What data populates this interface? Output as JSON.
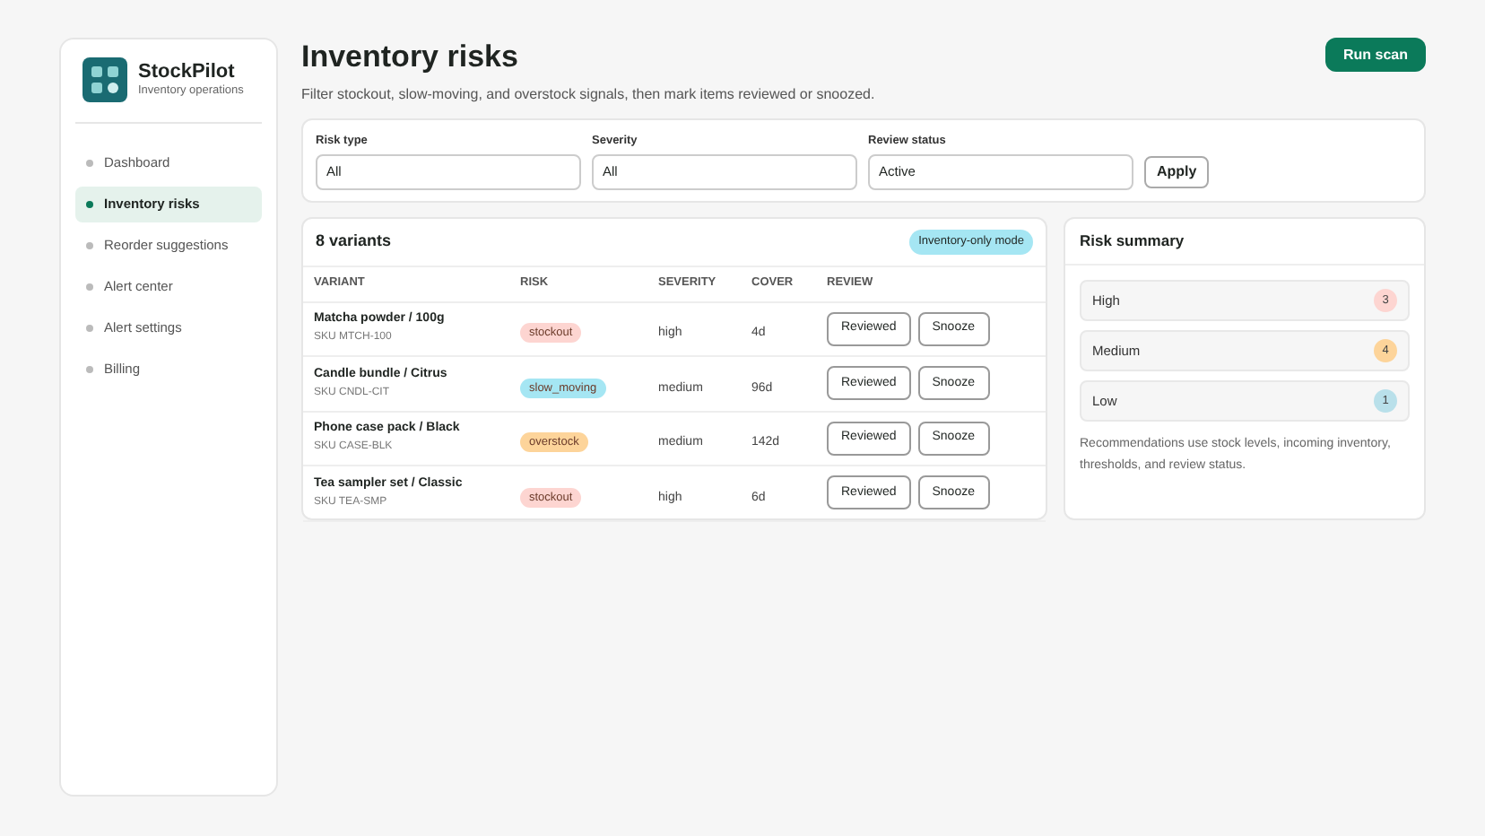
{
  "brand": {
    "name": "StockPilot",
    "subtitle": "Inventory operations"
  },
  "nav": [
    {
      "label": "Dashboard",
      "selected": false
    },
    {
      "label": "Inventory risks",
      "selected": true
    },
    {
      "label": "Reorder suggestions",
      "selected": false
    },
    {
      "label": "Alert center",
      "selected": false
    },
    {
      "label": "Alert settings",
      "selected": false
    },
    {
      "label": "Billing",
      "selected": false
    }
  ],
  "header": {
    "title": "Inventory risks",
    "subtitle": "Filter stockout, slow-moving, and overstock signals, then mark items reviewed or snoozed.",
    "action": "Run scan"
  },
  "filters": [
    {
      "label": "Risk type",
      "value": "All"
    },
    {
      "label": "Severity",
      "value": "All"
    },
    {
      "label": "Review status",
      "value": "Active"
    }
  ],
  "apply": "Apply",
  "table": {
    "title": "8 variants",
    "mode_badge": "Inventory-only mode",
    "columns": [
      "VARIANT",
      "RISK",
      "SEVERITY",
      "COVER",
      "REVIEW"
    ],
    "rows": [
      {
        "name": "Matcha powder / 100g",
        "sku": "SKU MTCH-100",
        "risk": "stockout",
        "color": "#fdd5d1",
        "severity": "high",
        "cover": "4d",
        "buttons": [
          "Reviewed",
          "Snooze"
        ]
      },
      {
        "name": "Candle bundle / Citrus",
        "sku": "SKU CNDL-CIT",
        "risk": "slow_moving",
        "color": "#a5e6f3",
        "severity": "medium",
        "cover": "96d",
        "buttons": [
          "Reviewed",
          "Snooze"
        ]
      },
      {
        "name": "Phone case pack / Black",
        "sku": "SKU CASE-BLK",
        "risk": "overstock",
        "color": "#fdd49a",
        "severity": "medium",
        "cover": "142d",
        "buttons": [
          "Reviewed",
          "Snooze"
        ]
      },
      {
        "name": "Tea sampler set / Classic",
        "sku": "SKU TEA-SMP",
        "risk": "stockout",
        "color": "#fdd5d1",
        "severity": "high",
        "cover": "6d",
        "buttons": [
          "Reviewed",
          "Snooze"
        ]
      }
    ]
  },
  "summary": {
    "title": "Risk summary",
    "items": [
      {
        "label": "High",
        "count": "3",
        "color": "#fdd5d1"
      },
      {
        "label": "Medium",
        "count": "4",
        "color": "#fdd49a"
      },
      {
        "label": "Low",
        "count": "1",
        "color": "#b9e0ea"
      }
    ],
    "note": "Recommendations use stock levels, incoming inventory, thresholds, and review status."
  }
}
